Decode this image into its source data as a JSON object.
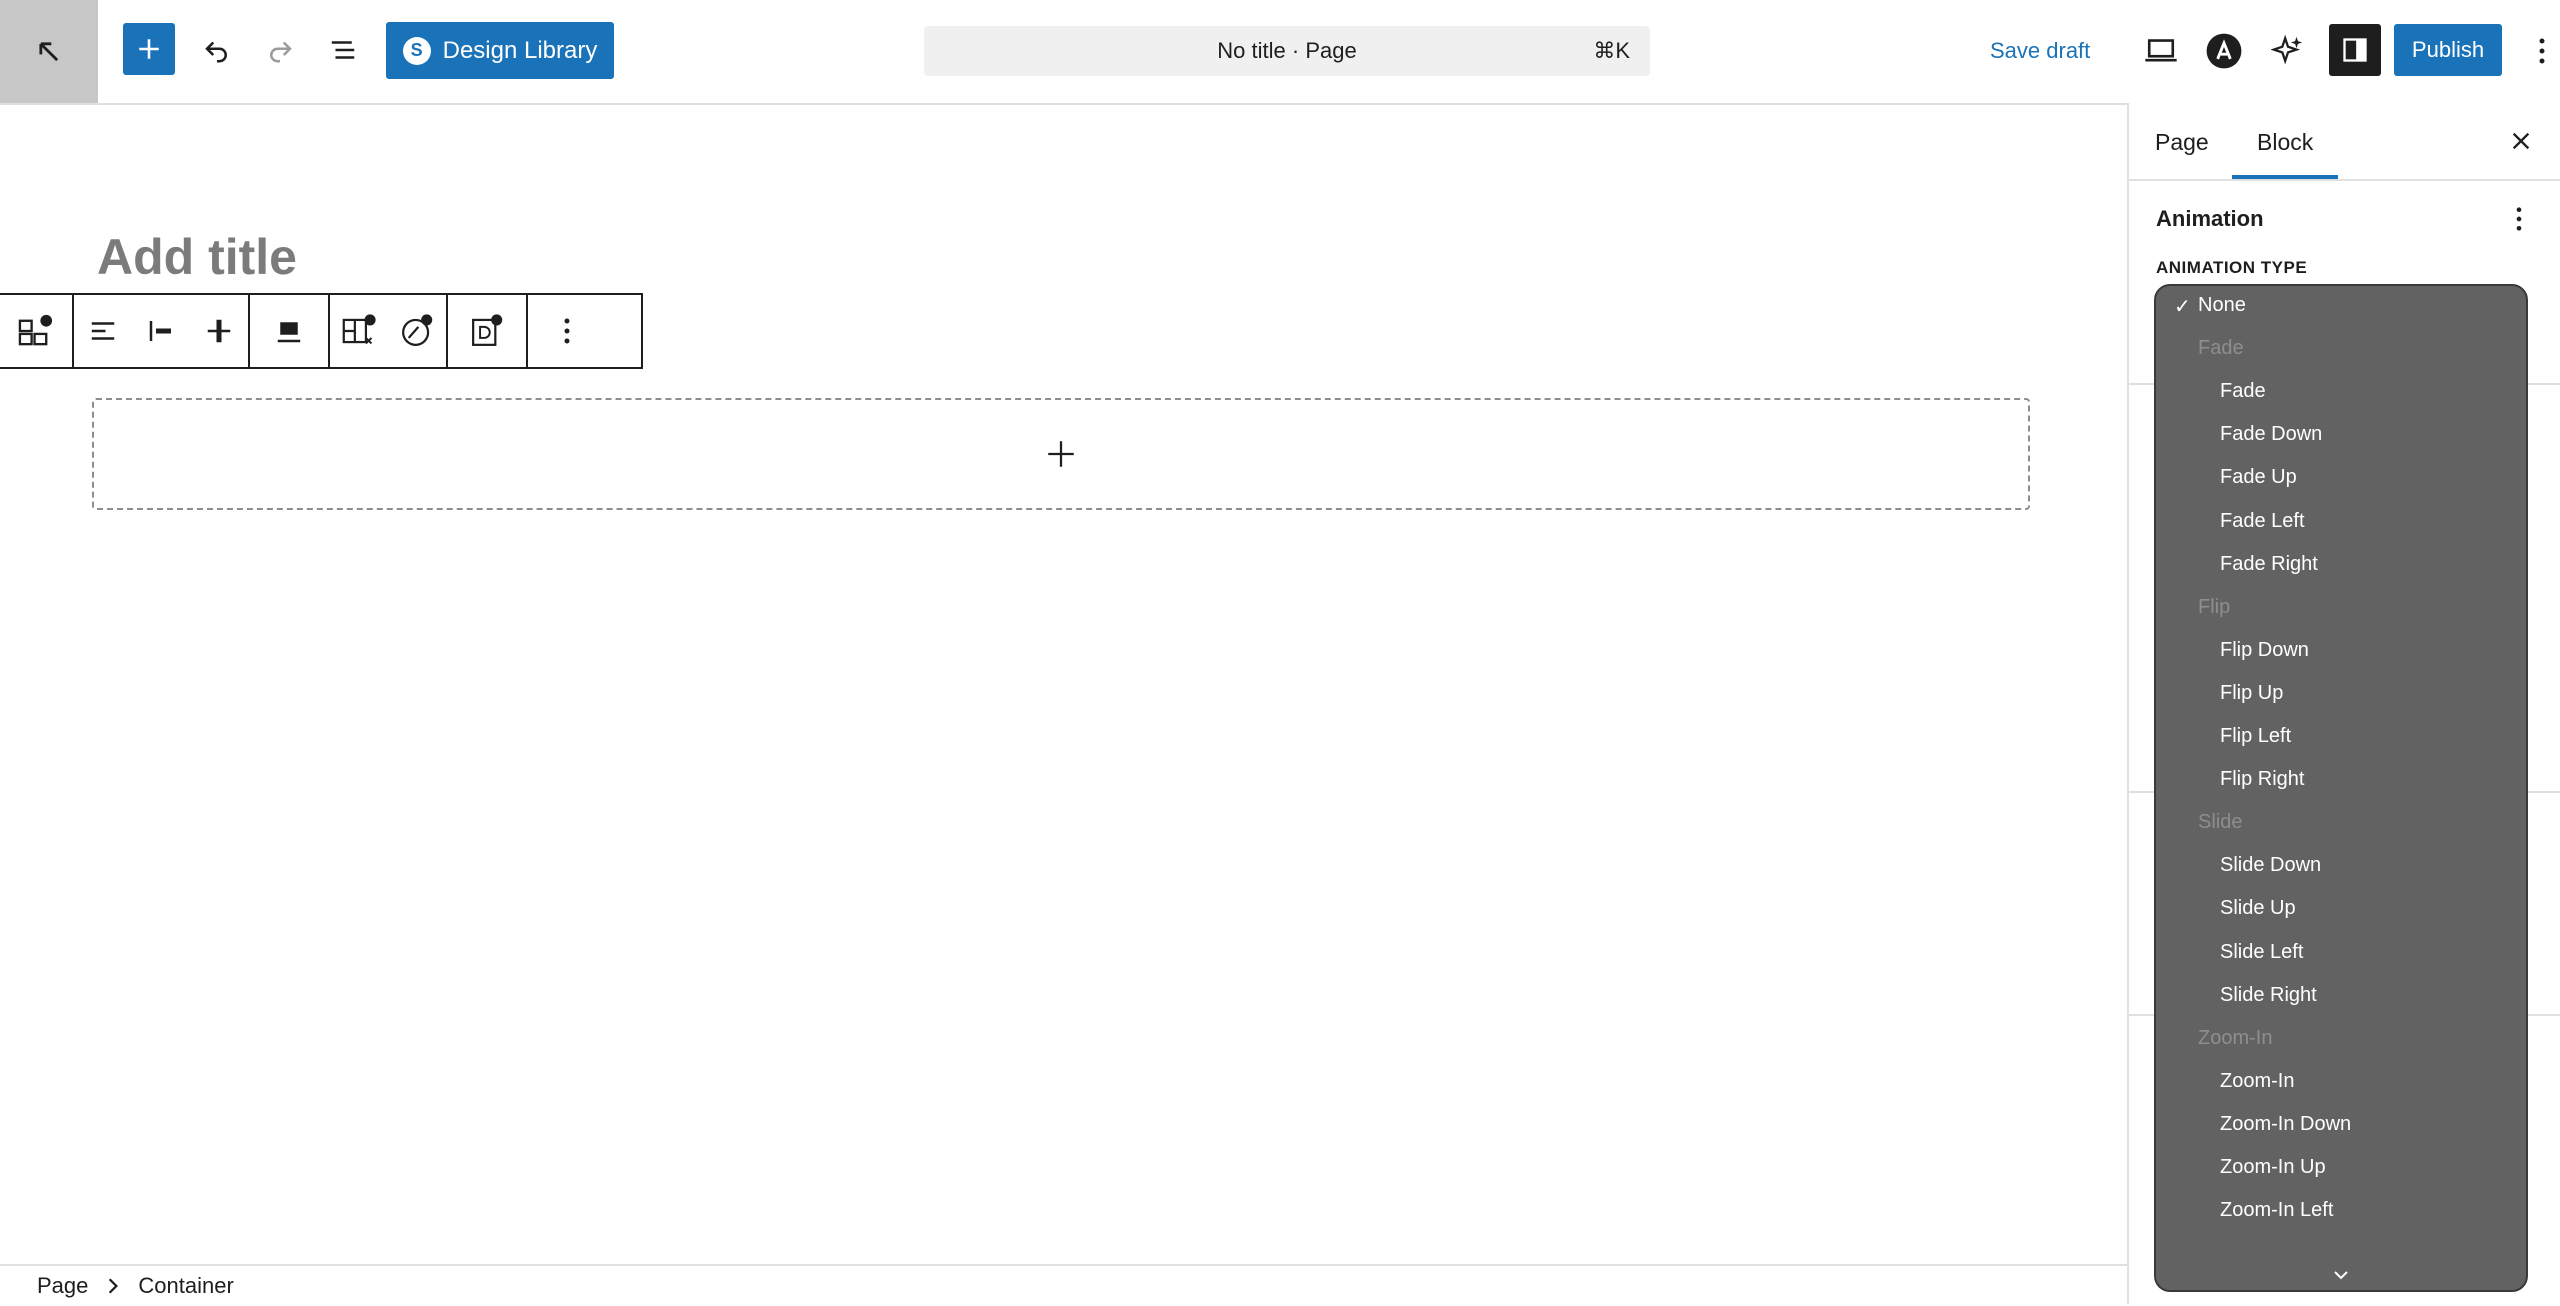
{
  "toolbar": {
    "design_library_label": "Design Library",
    "document_title": "No title · Page",
    "command_shortcut": "⌘K",
    "save_draft_label": "Save draft",
    "publish_label": "Publish"
  },
  "editor": {
    "title_placeholder": "Add title"
  },
  "breadcrumb": {
    "items": [
      "Page",
      "Container"
    ]
  },
  "sidebar": {
    "tabs": [
      "Page",
      "Block"
    ],
    "active_tab": "Block",
    "panel_title": "Animation",
    "field_label": "ANIMATION TYPE"
  },
  "dropdown": {
    "selected": "None",
    "options": [
      {
        "label": "None",
        "kind": "option"
      },
      {
        "label": "Fade",
        "kind": "group"
      },
      {
        "label": "Fade",
        "kind": "option"
      },
      {
        "label": "Fade Down",
        "kind": "option"
      },
      {
        "label": "Fade Up",
        "kind": "option"
      },
      {
        "label": "Fade Left",
        "kind": "option"
      },
      {
        "label": "Fade Right",
        "kind": "option"
      },
      {
        "label": "Flip",
        "kind": "group"
      },
      {
        "label": "Flip Down",
        "kind": "option"
      },
      {
        "label": "Flip Up",
        "kind": "option"
      },
      {
        "label": "Flip Left",
        "kind": "option"
      },
      {
        "label": "Flip Right",
        "kind": "option"
      },
      {
        "label": "Slide",
        "kind": "group"
      },
      {
        "label": "Slide Down",
        "kind": "option"
      },
      {
        "label": "Slide Up",
        "kind": "option"
      },
      {
        "label": "Slide Left",
        "kind": "option"
      },
      {
        "label": "Slide Right",
        "kind": "option"
      },
      {
        "label": "Zoom-In",
        "kind": "group"
      },
      {
        "label": "Zoom-In",
        "kind": "option"
      },
      {
        "label": "Zoom-In Down",
        "kind": "option"
      },
      {
        "label": "Zoom-In Up",
        "kind": "option"
      },
      {
        "label": "Zoom-In Left",
        "kind": "option"
      }
    ],
    "check_glyph": "✓"
  },
  "colors": {
    "accent": "#1a73b8",
    "dropdown_bg": "#626262",
    "group_label": "#8e8e8e"
  }
}
